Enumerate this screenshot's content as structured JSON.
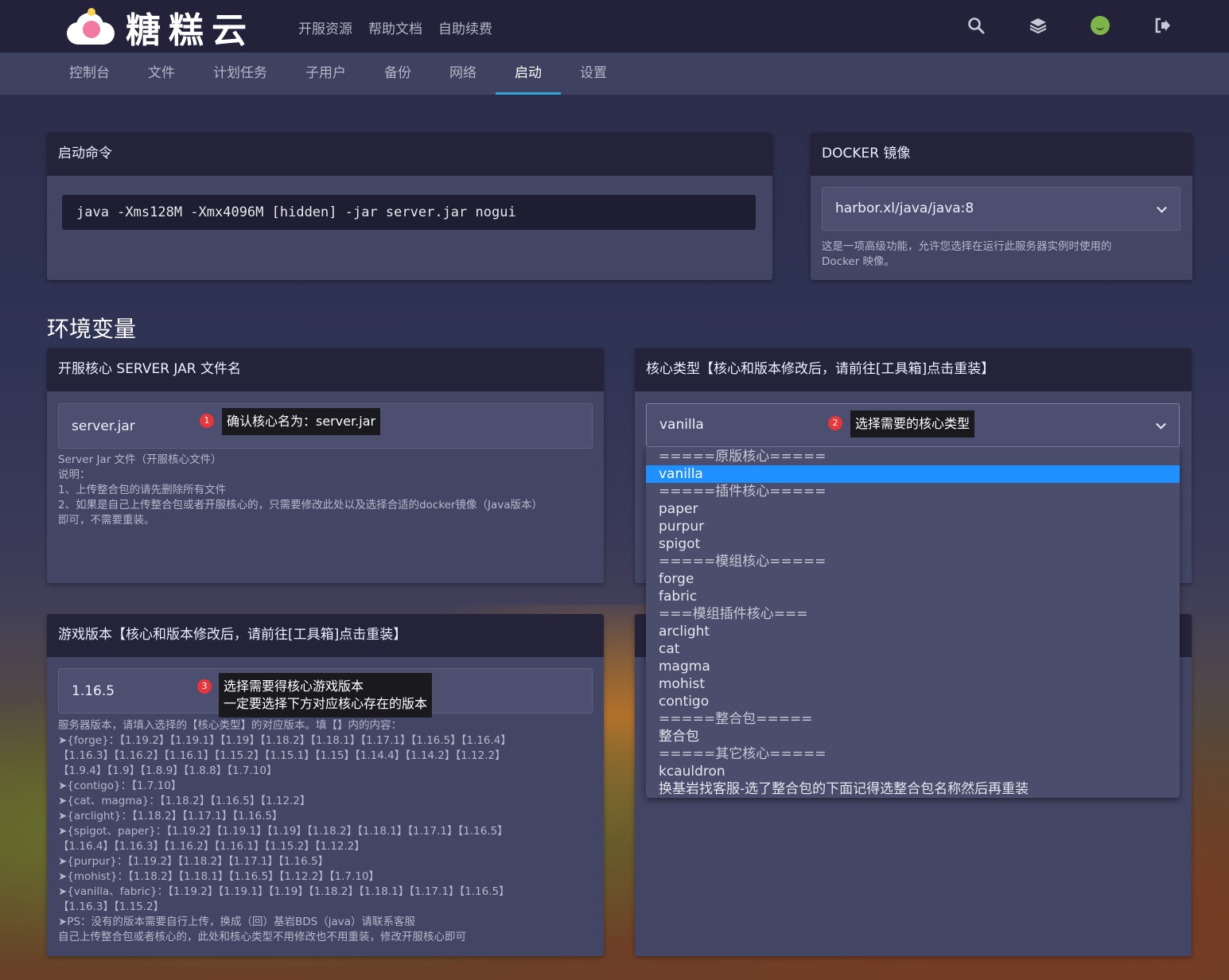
{
  "brand": {
    "name": "糖糕云"
  },
  "topnav": [
    "开服资源",
    "帮助文档",
    "自助续费"
  ],
  "top_icons": [
    "search-icon",
    "layers-icon",
    "avatar",
    "logout-icon"
  ],
  "subnav": {
    "items": [
      "控制台",
      "文件",
      "计划任务",
      "子用户",
      "备份",
      "网络",
      "启动",
      "设置"
    ],
    "active": "启动"
  },
  "startup": {
    "title": "启动命令",
    "command": "java -Xms128M -Xmx4096M [hidden] -jar server.jar nogui"
  },
  "docker": {
    "title": "DOCKER 镜像",
    "selected": "harbor.xl/java/java:8",
    "help_line1": "这是一项高级功能，允许您选择在运行此服务器实例时使用的",
    "help_line2": "Docker 映像。"
  },
  "env_title": "环境变量",
  "jar": {
    "title": "开服核心 SERVER JAR 文件名",
    "value": "server.jar",
    "badge": "1",
    "tip": "确认核心名为：server.jar",
    "help": [
      "Server Jar 文件（开服核心文件）",
      "说明：",
      "1、上传整合包的请先删除所有文件",
      "2、如果是自己上传整合包或者开服核心的，只需要修改此处以及选择合适的docker镜像（Java版本）",
      "即可，不需要重装。"
    ]
  },
  "core": {
    "title": "核心类型【核心和版本修改后，请前往[工具箱]点击重装】",
    "value": "vanilla",
    "badge": "2",
    "tip": "选择需要的核心类型",
    "options": [
      {
        "label": "=====原版核心=====",
        "kind": "group"
      },
      {
        "label": "vanilla",
        "kind": "selected"
      },
      {
        "label": "=====插件核心=====",
        "kind": "group"
      },
      {
        "label": "paper",
        "kind": "item"
      },
      {
        "label": "purpur",
        "kind": "item"
      },
      {
        "label": "spigot",
        "kind": "item"
      },
      {
        "label": "=====模组核心=====",
        "kind": "group"
      },
      {
        "label": "forge",
        "kind": "item"
      },
      {
        "label": "fabric",
        "kind": "item"
      },
      {
        "label": "===模组插件核心===",
        "kind": "group"
      },
      {
        "label": "arclight",
        "kind": "item"
      },
      {
        "label": "cat",
        "kind": "item"
      },
      {
        "label": "magma",
        "kind": "item"
      },
      {
        "label": "mohist",
        "kind": "item"
      },
      {
        "label": "contigo",
        "kind": "item"
      },
      {
        "label": "=====整合包=====",
        "kind": "group"
      },
      {
        "label": "整合包",
        "kind": "item"
      },
      {
        "label": "=====其它核心=====",
        "kind": "group"
      },
      {
        "label": "kcauldron",
        "kind": "item"
      },
      {
        "label": "换基岩找客服-选了整合包的下面记得选整合包名称然后再重装",
        "kind": "item"
      }
    ]
  },
  "version": {
    "title": "游戏版本【核心和版本修改后，请前往[工具箱]点击重装】",
    "value": "1.16.5",
    "badge": "3",
    "tip_line1": "选择需要得核心游戏版本",
    "tip_line2": "一定要选择下方对应核心存在的版本",
    "help": [
      "服务器版本，请填入选择的【核心类型】的对应版本。填【】内的内容：",
      "➤{forge}：【1.19.2】【1.19.1】【1.19】【1.18.2】【1.18.1】【1.17.1】【1.16.5】【1.16.4】",
      "【1.16.3】【1.16.2】【1.16.1】【1.15.2】【1.15.1】【1.15】【1.14.4】【1.14.2】【1.12.2】",
      "【1.9.4】【1.9】【1.8.9】【1.8.8】【1.7.10】",
      "➤{contigo}：【1.7.10】",
      "➤{cat、magma}：【1.18.2】【1.16.5】【1.12.2】",
      "➤{arclight}：【1.18.2】【1.17.1】【1.16.5】",
      "➤{spigot、paper}：【1.19.2】【1.19.1】【1.19】【1.18.2】【1.18.1】【1.17.1】【1.16.5】",
      "【1.16.4】【1.16.3】【1.16.2】【1.16.1】【1.15.2】【1.12.2】",
      "➤{purpur}：【1.19.2】【1.18.2】【1.17.1】【1.16.5】",
      "➤{mohist}：【1.18.2】【1.18.1】【1.16.5】【1.12.2】【1.7.10】",
      "➤{vanilla、fabric}：【1.19.2】【1.19.1】【1.19】【1.18.2】【1.18.1】【1.17.1】【1.16.5】",
      "【1.16.3】【1.15.2】",
      "➤PS：没有的版本需要自行上传，换成（回）基岩BDS（java）请联系客服",
      "自己上传整合包或者核心的，此处和核心类型不用修改也不用重装，修改开服核心即可"
    ]
  }
}
